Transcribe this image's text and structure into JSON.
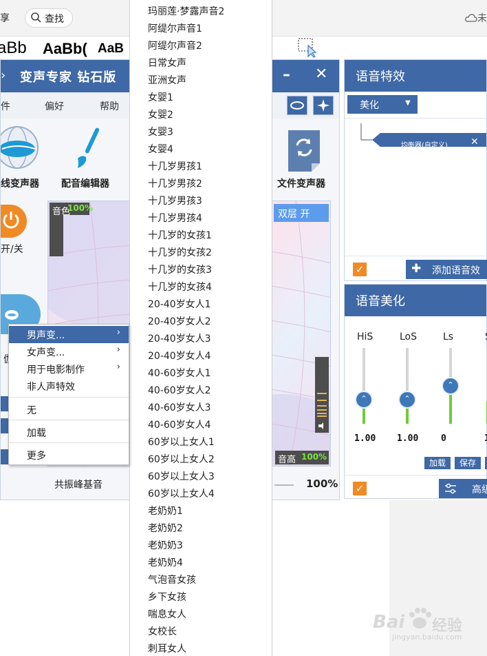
{
  "toolbar": {
    "share_label": "享",
    "search_label": "查找",
    "font_samples": [
      "aBb",
      "AaBb(",
      "AaB"
    ],
    "cloud_label": "未"
  },
  "app": {
    "title": "变声专家 钻石版",
    "menu": [
      "件",
      "偏好",
      "帮助"
    ],
    "tools": [
      "线变声器",
      "配音编辑器",
      "文件变声器"
    ],
    "power_label": "开/关",
    "timbre_label": "音色",
    "timbre_value": "100%",
    "double_layer": "双层 开",
    "pitch_label": "音高",
    "pitch_value": "100%",
    "resonance_label": "共振峰基音",
    "zoom_value": "100%",
    "cut_label": "伽"
  },
  "context_menu": {
    "items": [
      {
        "label": "男声变...",
        "submenu": true
      },
      {
        "label": "女声变...",
        "submenu": true
      },
      {
        "label": "用于电影制作",
        "submenu": true
      },
      {
        "label": "非人声特效",
        "submenu": false
      },
      {
        "label": "无",
        "submenu": false
      },
      {
        "label": "加载",
        "submenu": false
      },
      {
        "label": "更多",
        "submenu": false
      }
    ]
  },
  "voice_list": [
    "玛丽莲·梦露声音2",
    "阿缇尔声音1",
    "阿缇尔声音2",
    "日常女声",
    "亚洲女声",
    "女婴1",
    "女婴2",
    "女婴3",
    "女婴4",
    "十几岁男孩1",
    "十几岁男孩2",
    "十几岁男孩3",
    "十几岁男孩4",
    "十几岁的女孩1",
    "十几岁的女孩2",
    "十几岁的女孩3",
    "十几岁的女孩4",
    "20-40岁女人1",
    "20-40岁女人2",
    "20-40岁女人3",
    "20-40岁女人4",
    "40-60岁女人1",
    "40-60岁女人2",
    "40-60岁女人3",
    "40-60岁女人4",
    "60岁以上女人1",
    "60岁以上女人2",
    "60岁以上女人3",
    "60岁以上女人4",
    "老奶奶1",
    "老奶奶2",
    "老奶奶3",
    "老奶奶4",
    "气泡音女孩",
    "乡下女孩",
    "喘息女人",
    "女校长",
    "刺耳女人"
  ],
  "voice_effects": {
    "title": "语音特效",
    "dropdown": "美化",
    "node_label": "均衡器(自定义)",
    "add_label": "添加语音效"
  },
  "voice_beauty": {
    "title": "语音美化",
    "sliders": [
      {
        "label": "HiS",
        "value": "1.00"
      },
      {
        "label": "LoS",
        "value": "1.00"
      },
      {
        "label": "Ls",
        "value": "0"
      },
      {
        "label": "S",
        "value": "1"
      }
    ],
    "load_label": "加载",
    "save_label": "保存",
    "advanced_label": "高级"
  },
  "watermark": {
    "brand": "Bai",
    "brand2": "经验",
    "url": "jingyan.baidu.com"
  },
  "colors": {
    "accent": "#3e68a6",
    "orange": "#f08a24",
    "green": "#6fcb3a"
  }
}
